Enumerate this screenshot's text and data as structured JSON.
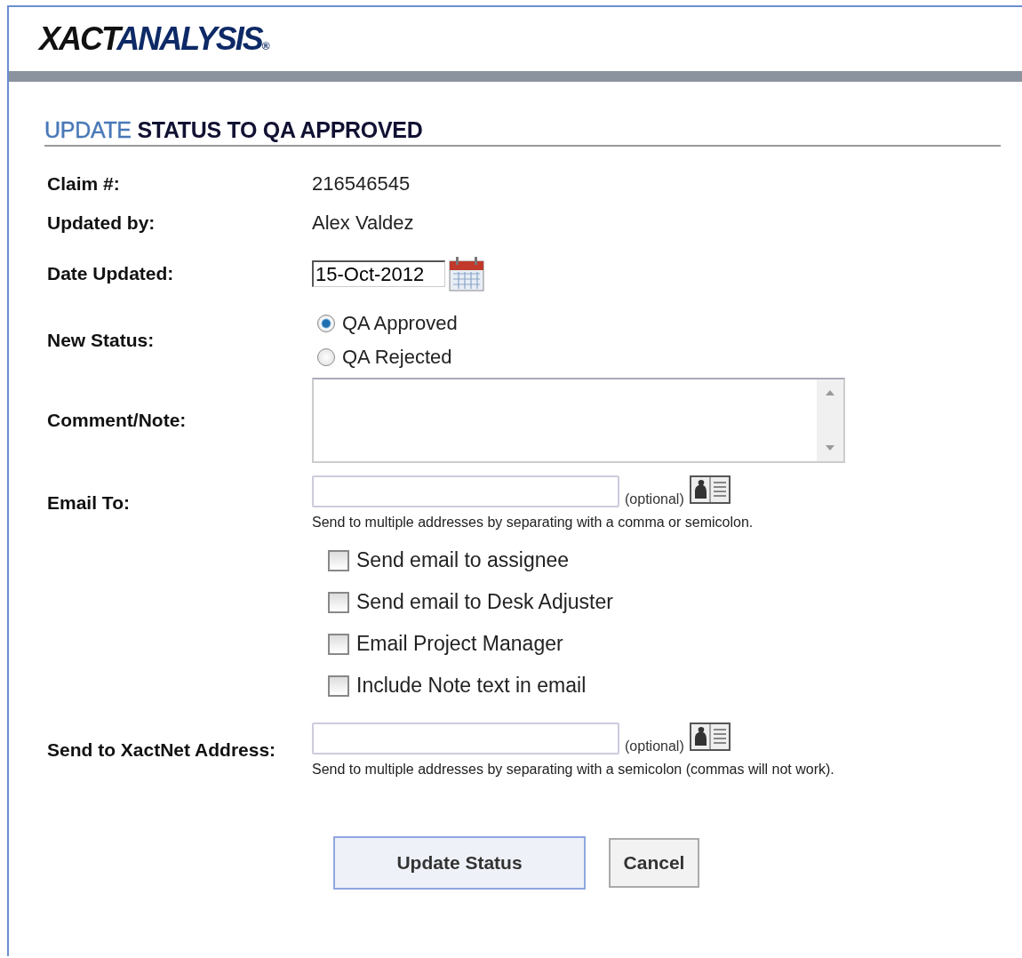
{
  "logo": {
    "dark_part": "XACT",
    "blue_part": "ANALYSIS",
    "mark": "®"
  },
  "title": {
    "lead": "UPDATE",
    "rest": "STATUS TO QA APPROVED"
  },
  "fields": [
    {
      "kind": "text",
      "label": "Claim #:",
      "value": "216546545"
    },
    {
      "kind": "text",
      "label": "Updated by:",
      "value": "Alex Valdez"
    },
    {
      "kind": "date",
      "label": "Date Updated:",
      "value": "15-Oct-2012"
    },
    {
      "kind": "radio",
      "label": "New Status:",
      "options": [
        {
          "label": "QA Approved",
          "selected": true
        },
        {
          "label": "QA Rejected",
          "selected": false
        }
      ]
    },
    {
      "kind": "textarea",
      "label": "Comment/Note:"
    },
    {
      "kind": "email",
      "label": "Email To:",
      "optional": "(optional)",
      "hint": "Send to multiple addresses by separating with a comma or semicolon."
    },
    {
      "kind": "checks",
      "options": [
        {
          "label": "Send email to assignee",
          "checked": false
        },
        {
          "label": "Send email to Desk Adjuster",
          "checked": false
        },
        {
          "label": "Email Project Manager",
          "checked": false
        },
        {
          "label": "Include Note text in email",
          "checked": false
        }
      ]
    },
    {
      "kind": "email",
      "label": "Send to XactNet Address:",
      "optional": "(optional)",
      "hint": "Send to multiple addresses by separating with a semicolon (commas will not work)."
    }
  ],
  "buttons": [
    {
      "kind": "primary",
      "label": "Update Status"
    },
    {
      "kind": "secondary",
      "label": "Cancel"
    }
  ]
}
